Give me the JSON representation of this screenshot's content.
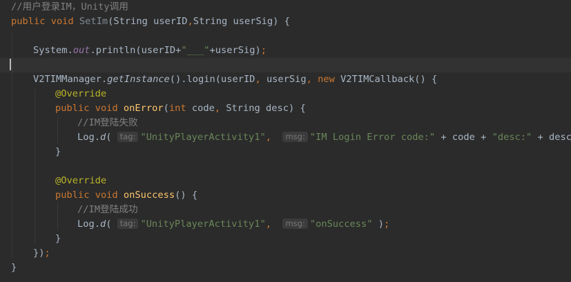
{
  "comments": {
    "c1": "//用户登录IM，Unity调用",
    "c2": "//IM登陆失败",
    "c3": "//IM登陆成功"
  },
  "kw": {
    "public": "public",
    "void": "void",
    "new": "new",
    "int": "int"
  },
  "names": {
    "set_im": "SetIm",
    "string": "String",
    "user_id": "userID",
    "user_sig": "userSig",
    "system": "System",
    "out": "out",
    "println": "println",
    "manager": "V2TIMManager",
    "get_instance": "getInstance",
    "login": "login",
    "callback": "V2TIMCallback",
    "override": "@Override",
    "on_error": "onError",
    "code": "code",
    "desc": "desc",
    "log": "Log",
    "d": "d",
    "on_success": "onSuccess"
  },
  "strings": {
    "underscores": "\"___\"",
    "activity": "\"UnityPlayerActivity1\"",
    "error_code": "\"IM Login Error code:\"",
    "desc_label": "\"desc:\"",
    "on_success": "\"onSuccess\""
  },
  "hints": {
    "tag": "tag:",
    "msg": "msg:"
  },
  "colors": {
    "background": "#2b2b2b",
    "keyword": "#cc7832",
    "method": "#ffc66d",
    "string": "#6a8759",
    "comment": "#808080",
    "annotation": "#bbb529",
    "field": "#9876aa",
    "text": "#a9b7c6"
  }
}
